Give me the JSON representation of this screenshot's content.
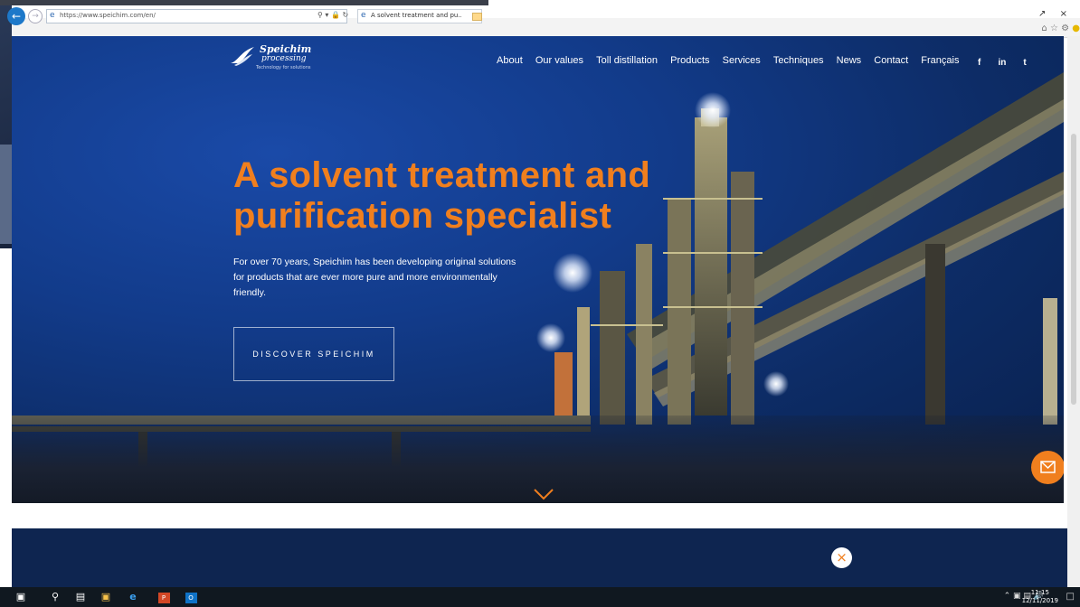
{
  "browser": {
    "url": "https://www.speichim.com/en/",
    "tab_title": "A solvent treatment and pu...",
    "back_icon": "back-arrow-icon",
    "forward_icon": "forward-arrow-icon"
  },
  "site": {
    "logo_line1": "Speichim",
    "logo_line2": "processing",
    "logo_tagline": "Technology for solutions",
    "nav": [
      "About",
      "Our values",
      "Toll distillation",
      "Products",
      "Services",
      "Techniques",
      "News",
      "Contact",
      "Français"
    ],
    "social": [
      "f",
      "in",
      "t"
    ],
    "headline": "A solvent treatment and purification specialist",
    "subtext": "For over 70 years, Speichim has been developing original solutions for products that are ever more pure and more environmentally friendly.",
    "cta": "DISCOVER SPEICHIM",
    "accent_color": "#f07f1e",
    "navy_color": "#0e2550"
  },
  "taskbar": {
    "time": "11:15",
    "date": "12/11/2019"
  }
}
